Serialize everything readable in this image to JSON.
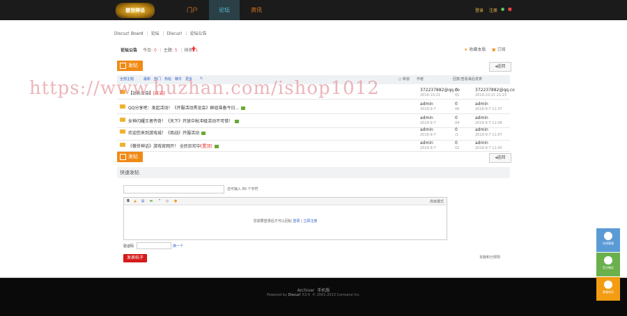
{
  "header": {
    "logo_text": "傲世神话",
    "nav": [
      {
        "label": "门户",
        "active": false
      },
      {
        "label": "论坛",
        "active": true
      },
      {
        "label": "资讯",
        "active": false
      }
    ],
    "login": "登录",
    "register": "注册"
  },
  "breadcrumb": [
    "Discuz! Board",
    "论坛",
    "Discuz!",
    "论坛公告"
  ],
  "forum": {
    "title": "论坛公告",
    "today_label": "今日:",
    "today": "0",
    "topics_label": "主题:",
    "topics": "5",
    "rank_label": "排名:",
    "rank": "1",
    "favorite": "收藏本版",
    "subscribe": "订阅"
  },
  "buttons": {
    "post": "发帖",
    "back": "返回",
    "submit": "发表帖子"
  },
  "table": {
    "filter_all": "全部主题",
    "filters": [
      "最新",
      "热门",
      "热帖",
      "精华",
      "更多"
    ],
    "new_window": "新窗",
    "col_author": "作者",
    "col_counts": "回复/查看",
    "col_last": "最后发表"
  },
  "threads": [
    {
      "title_prefix": "【站长公告】",
      "title_red": "[正式]",
      "author": "372237882@qq.co",
      "author_date": "2019-10-21",
      "replies": "0",
      "views": "01",
      "last_user": "372237882@qq.co",
      "last_date": "2019-10-21 21:23"
    },
    {
      "title_prefix": "QQ分享吧：发起活动！《开服活动黑龙会》群组准备今日...",
      "title_red": "",
      "author": "admin",
      "author_date": "2019-9-7",
      "replies": "0",
      "views": "06",
      "last_user": "admin",
      "last_date": "2019-9-7 11:37"
    },
    {
      "title_prefix": "女神闪耀王者传奇！《天下》开放中秋冲级活动不可错！",
      "title_red": "",
      "author": "admin",
      "author_date": "2019-9-7",
      "replies": "0",
      "views": "04",
      "last_user": "admin",
      "last_date": "2019-9-7 11:08"
    },
    {
      "title_prefix": "欢迎您来到游戏城！《商战》开服活动",
      "title_red": "",
      "author": "admin",
      "author_date": "2019-9-7",
      "replies": "0",
      "views": "/1",
      "last_user": "admin",
      "last_date": "2019-9-7 11:07"
    },
    {
      "title_prefix": "《傲世神话》游戏官网开！ 全民狂欢中",
      "title_red": "[置顶]",
      "author": "admin",
      "author_date": "2019-9-7",
      "replies": "0",
      "views": "02",
      "last_user": "admin",
      "last_date": "2019-9-7 11:00"
    }
  ],
  "quick_post": {
    "heading": "快速发帖",
    "char_hint": "还可输入 80 个字符",
    "mode": "高级模式",
    "login_msg": "您需要登录后才可以回帖",
    "login_link": "登录",
    "register_link": "立即注册",
    "captcha_label": "验证码",
    "captcha_refresh": "换一个",
    "rules": "本版积分规则"
  },
  "footer": {
    "archive": "Archiver",
    "mobile": "手机版",
    "powered": "Powered by",
    "brand": "Discuz!",
    "version": "X3.4",
    "copyright": "© 2001-2013 Comsenz Inc."
  },
  "side": [
    {
      "label": "在线客服",
      "color": "#5b9bd5"
    },
    {
      "label": "官方微信",
      "color": "#6ab04c"
    },
    {
      "label": "客服电话",
      "color": "#f39c12"
    }
  ],
  "watermark": "https://www.huzhan.com/ishop1012",
  "colors": {
    "accent": "#f08a15",
    "nav_active": "#5bc0de",
    "danger": "#d51a1a"
  }
}
